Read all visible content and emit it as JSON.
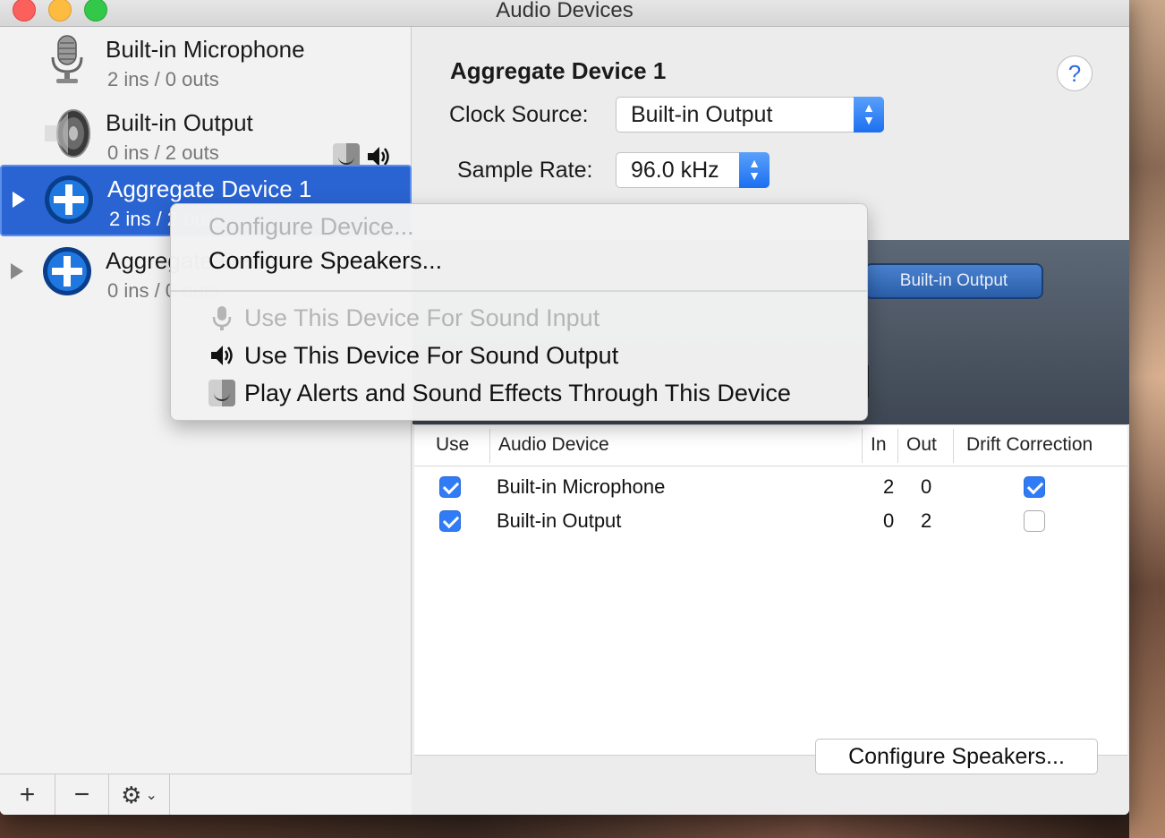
{
  "window": {
    "title": "Audio Devices"
  },
  "sidebar": {
    "devices": [
      {
        "name": "Built-in Microphone",
        "io": "2 ins / 0 outs",
        "icon": "microphone-icon"
      },
      {
        "name": "Built-in Output",
        "io": "0 ins / 2 outs",
        "icon": "speaker-icon"
      },
      {
        "name": "Aggregate Device 1",
        "io": "2 ins / 2 outs",
        "icon": "aggregate-device-icon",
        "selected": true
      },
      {
        "name": "Aggregate Device 2",
        "io": "0 ins / 0 outs",
        "icon": "aggregate-device-icon"
      }
    ],
    "footer": {
      "add": "+",
      "remove": "−",
      "gear": "⚙"
    }
  },
  "detail": {
    "device_title": "Aggregate Device 1",
    "help": "?",
    "clock_source_label": "Clock Source:",
    "clock_source_value": "Built-in Output",
    "sample_rate_label": "Sample Rate:",
    "sample_rate_value": "96.0 kHz",
    "pill_label": "Built-in Output",
    "table": {
      "headers": [
        "Use",
        "Audio Device",
        "In",
        "Out",
        "Drift Correction"
      ],
      "rows": [
        {
          "use": true,
          "device": "Built-in Microphone",
          "in": "2",
          "out": "0",
          "drift": true
        },
        {
          "use": true,
          "device": "Built-in Output",
          "in": "0",
          "out": "2",
          "drift": false
        }
      ]
    },
    "configure_speakers_button": "Configure Speakers..."
  },
  "context_menu": {
    "items": [
      {
        "label": "Configure Device...",
        "enabled": false
      },
      {
        "label": "Configure Speakers...",
        "enabled": true
      },
      {
        "label": "Use This Device For Sound Input",
        "enabled": false,
        "icon": "microphone-icon"
      },
      {
        "label": "Use This Device For Sound Output",
        "enabled": true,
        "icon": "speaker-icon"
      },
      {
        "label": "Play Alerts and Sound Effects Through This Device",
        "enabled": true,
        "icon": "finder-icon"
      }
    ]
  },
  "colors": {
    "selection": "#2a64d2",
    "accent": "#2f7cf6",
    "close": "#fc605c",
    "minimize": "#fdbc40",
    "zoom": "#34c84a"
  }
}
